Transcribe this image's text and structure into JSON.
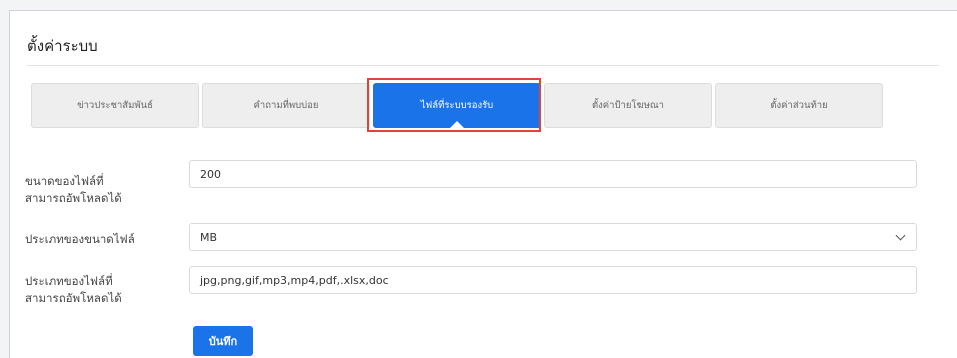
{
  "page": {
    "title": "ตั้งค่าระบบ"
  },
  "tabs": [
    {
      "label": "ข่าวประชาสัมพันธ์",
      "active": false
    },
    {
      "label": "คำถามที่พบบ่อย",
      "active": false
    },
    {
      "label": "ไฟล์ที่ระบบรองรับ",
      "active": true
    },
    {
      "label": "ตั้งค่าป้ายโฆษณา",
      "active": false
    },
    {
      "label": "ตั้งค่าส่วนท้าย",
      "active": false
    }
  ],
  "form": {
    "max_upload_size": {
      "label_line1": "ขนาดของไฟล์ที่",
      "label_line2": "สามารถอัพโหลดได้",
      "value": "200"
    },
    "size_unit": {
      "label": "ประเภทของขนาดไฟล์",
      "value": "MB"
    },
    "allowed_types": {
      "label_line1": "ประเภทของไฟล์ที่",
      "label_line2": "สามารถอัพโหลดได้",
      "value": "jpg,png,gif,mp3,mp4,pdf,.xlsx,doc"
    },
    "save_label": "บันทึก"
  },
  "colors": {
    "accent": "#1a73e8",
    "highlight": "#e0433a"
  }
}
